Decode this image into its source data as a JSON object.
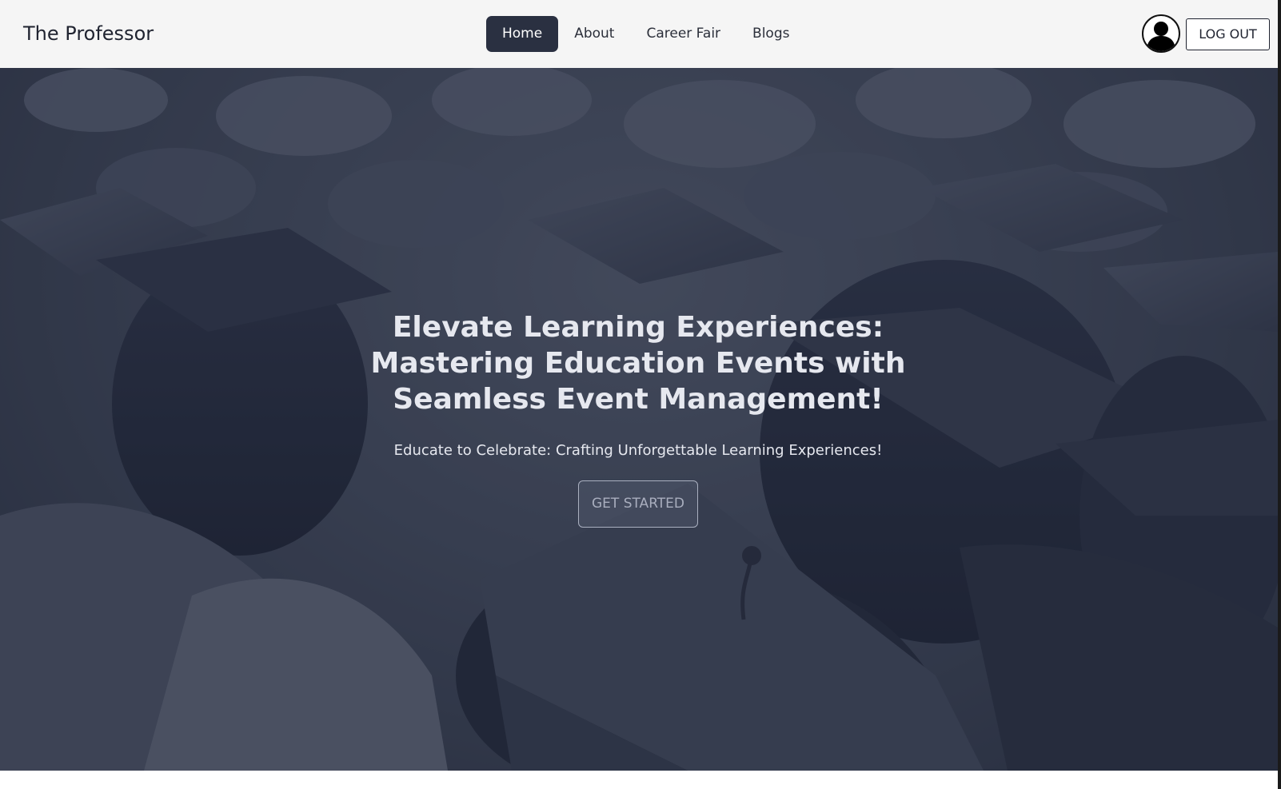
{
  "navbar": {
    "brand": "The Professor",
    "links": [
      {
        "label": "Home",
        "active": true
      },
      {
        "label": "About",
        "active": false
      },
      {
        "label": "Career Fair",
        "active": false
      },
      {
        "label": "Blogs",
        "active": false
      }
    ],
    "logout_label": "LOG OUT",
    "avatar_icon": "user-silhouette-icon"
  },
  "hero": {
    "title": "Elevate Learning Experiences: Mastering Education Events with Seamless Event Management!",
    "subtitle": "Educate to Celebrate: Crafting Unforgettable Learning Experiences!",
    "cta_label": "GET STARTED",
    "background_image": "graduation-caps-crowd-photo"
  },
  "colors": {
    "active_nav_bg": "#2a3041",
    "navbar_bg": "#f5f5f5",
    "hero_overlay": "#1f2637"
  }
}
